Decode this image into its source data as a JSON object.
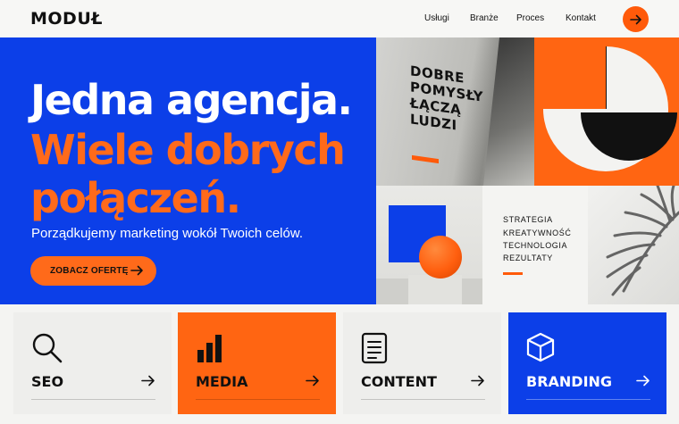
{
  "brand": {
    "logo": "MODUŁ"
  },
  "nav": {
    "items": [
      {
        "label": "Usługi"
      },
      {
        "label": "Branże"
      },
      {
        "label": "Proces"
      },
      {
        "label": "Kontakt"
      }
    ],
    "cta_icon": "arrow-right-icon"
  },
  "hero": {
    "line1": "Jedna agencja.",
    "line2": "Wiele dobrych",
    "line3": "połączeń.",
    "subtitle": "Porządkujemy marketing wokół Twoich celów.",
    "button_label": "ZOBACZ OFERTĘ",
    "button_icon": "arrow-right-icon"
  },
  "gallery": {
    "wall_text": [
      "DOBRE",
      "POMYSŁY",
      "ŁĄCZĄ",
      "LUDZI"
    ],
    "list": [
      "STRATEGIA",
      "KREATYWNOŚĆ",
      "TECHNOLOGIA",
      "REZULTATY"
    ]
  },
  "services": [
    {
      "title": "SEO",
      "icon": "search-icon"
    },
    {
      "title": "MEDIA",
      "icon": "bar-chart-icon"
    },
    {
      "title": "CONTENT",
      "icon": "document-icon"
    },
    {
      "title": "BRANDING",
      "icon": "cube-icon"
    }
  ],
  "colors": {
    "blue": "#0c3fe8",
    "orange": "#ff6512",
    "dark": "#111111",
    "light": "#eeeeec"
  }
}
